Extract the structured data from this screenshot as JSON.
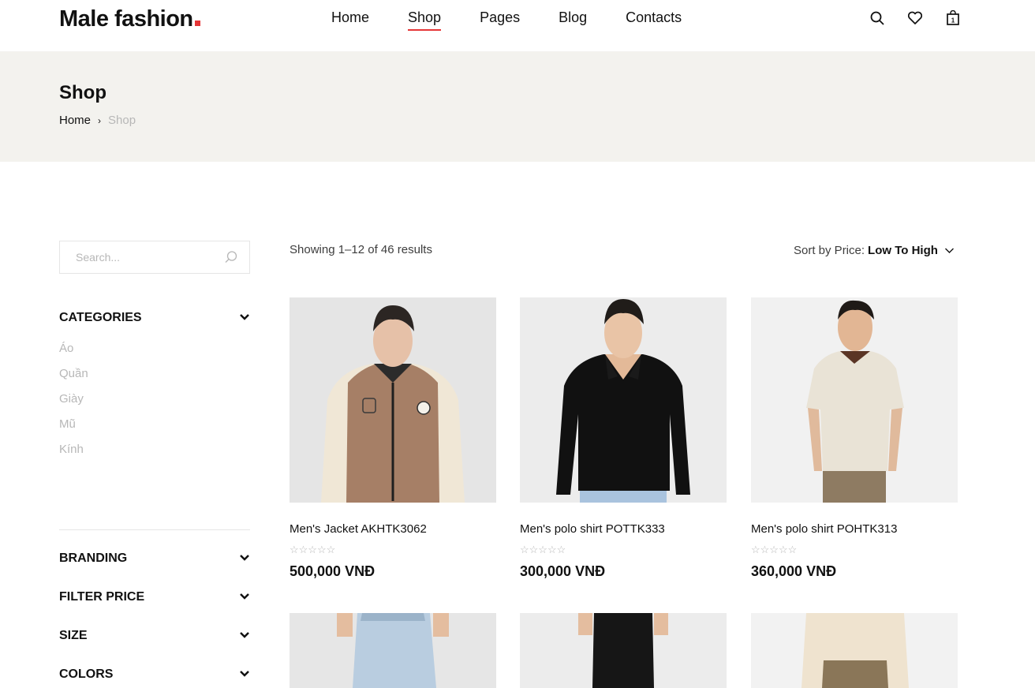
{
  "header": {
    "logo": "Male fashion",
    "nav": [
      "Home",
      "Shop",
      "Pages",
      "Blog",
      "Contacts"
    ],
    "active_nav": "Shop",
    "cart_count": "1"
  },
  "banner": {
    "title": "Shop",
    "breadcrumb_home": "Home",
    "breadcrumb_current": "Shop"
  },
  "sidebar": {
    "search_placeholder": "Search...",
    "categories_title": "CATEGORIES",
    "categories": [
      "Áo",
      "Quần",
      "Giày",
      "Mũ",
      "Kính"
    ],
    "branding_title": "BRANDING",
    "price_title": "FILTER PRICE",
    "size_title": "SIZE",
    "colors_title": "COLORS"
  },
  "toolbar": {
    "showing": "Showing 1–12 of 46 results",
    "sort_label": "Sort by Price:",
    "sort_value": "Low To High"
  },
  "products": [
    {
      "name": "Men's Jacket AKHTK3062",
      "price": "500,000 VNĐ",
      "stars": "☆☆☆☆☆"
    },
    {
      "name": "Men's polo shirt POTTK333",
      "price": "300,000 VNĐ",
      "stars": "☆☆☆☆☆"
    },
    {
      "name": "Men's polo shirt POHTK313",
      "price": "360,000 VNĐ",
      "stars": "☆☆☆☆☆"
    }
  ],
  "colors": {
    "accent": "#e53637",
    "banner_bg": "#f3f2ee"
  }
}
